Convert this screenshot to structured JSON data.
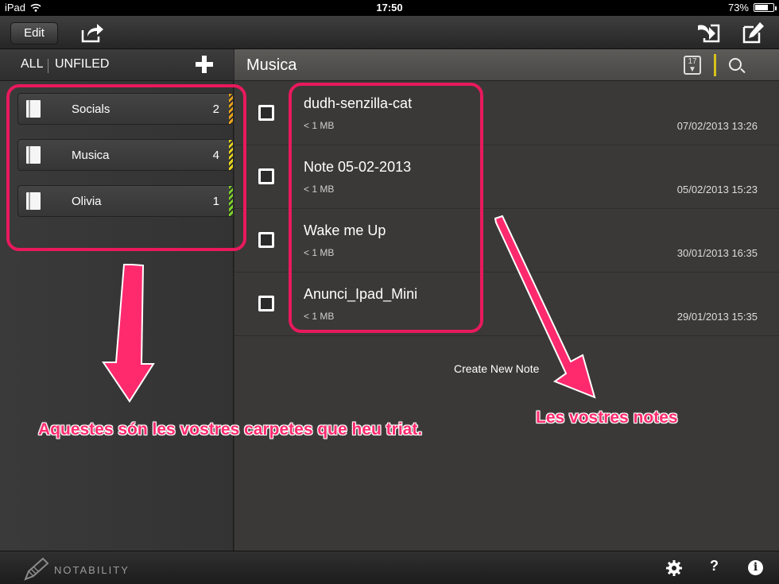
{
  "status_bar": {
    "device": "iPad",
    "time": "17:50",
    "battery": "73%",
    "battery_level": 0.73
  },
  "toolbar": {
    "edit_label": "Edit",
    "icons": [
      "share-icon",
      "import-icon",
      "compose-icon"
    ]
  },
  "sidebar": {
    "tab_all": "ALL",
    "tab_unfiled": "UNFILED",
    "add_icon": "plus-icon",
    "folders": [
      {
        "name": "Socials",
        "count": "2",
        "color": "#e8a21a"
      },
      {
        "name": "Musica",
        "count": "4",
        "color": "#e6d21c"
      },
      {
        "name": "Olivia",
        "count": "1",
        "color": "#7ccf2a"
      }
    ]
  },
  "main": {
    "title": "Musica",
    "sort_icon_label": "17",
    "notes": [
      {
        "title": "dudh-senzilla-cat",
        "size": "< 1 MB",
        "date": "07/02/2013 13:26"
      },
      {
        "title": "Note 05-02-2013",
        "size": "< 1 MB",
        "date": "05/02/2013 15:23"
      },
      {
        "title": "Wake me Up",
        "size": "< 1 MB",
        "date": "30/01/2013 16:35"
      },
      {
        "title": "Anunci_Ipad_Mini",
        "size": "< 1 MB",
        "date": "29/01/2013 15:35"
      }
    ],
    "create_note": "Create New Note"
  },
  "bottom_bar": {
    "logo_text": "NOTABILITY",
    "help_label": "?",
    "info_label": "i"
  },
  "annotations": {
    "folders_caption": "Aquestes són les vostres carpetes que heu triat.",
    "notes_caption": "Les vostres notes",
    "color": "#e8195c"
  }
}
